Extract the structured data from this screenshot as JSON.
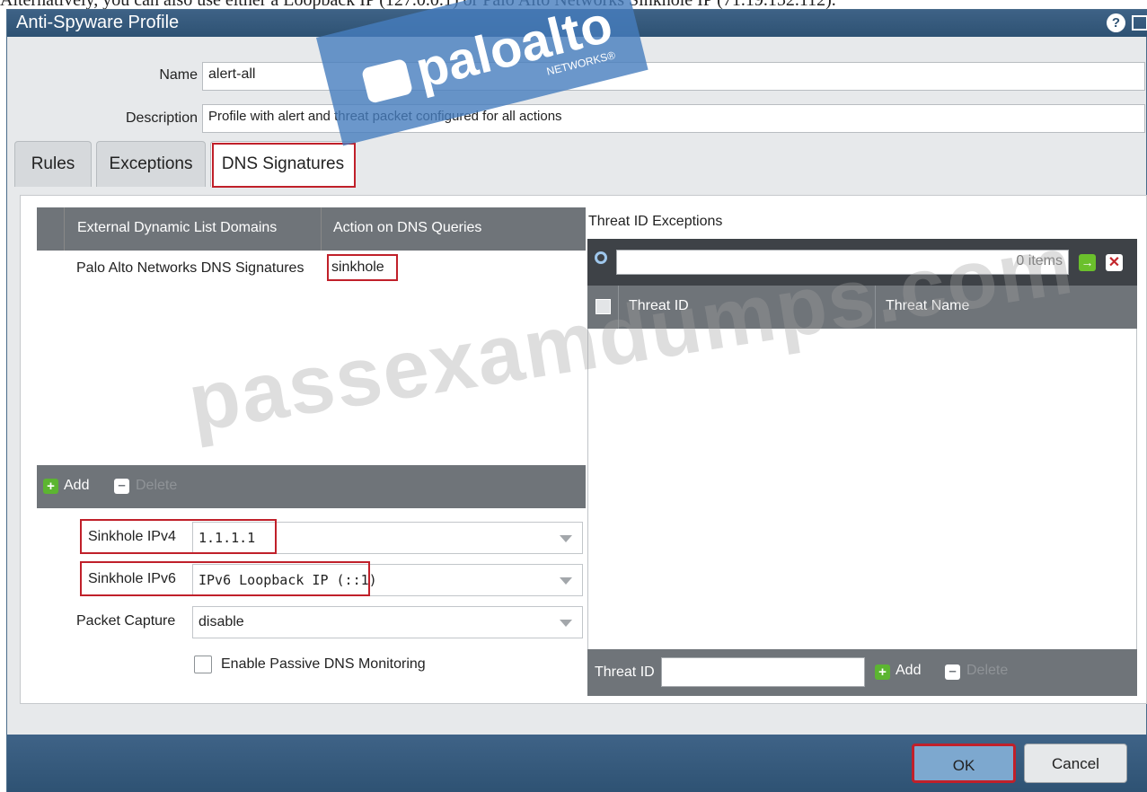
{
  "caption": "Alternatively, you can also use either a Loopback IP (127.0.0.1) or Palo Alto Networks Sinkhole IP (71.19.152.112).",
  "window": {
    "title": "Anti-Spyware Profile",
    "help_icon": "question-circle-icon",
    "maximize_icon": "maximize-icon"
  },
  "form": {
    "name_label": "Name",
    "name_value": "alert-all",
    "description_label": "Description",
    "description_value": "Profile with alert and threat packet configured for all actions"
  },
  "tabs": [
    {
      "label": "Rules"
    },
    {
      "label": "Exceptions"
    },
    {
      "label": "DNS Signatures",
      "active": true
    }
  ],
  "dns_table": {
    "headers": [
      "External Dynamic List Domains",
      "Action on DNS Queries"
    ],
    "rows": [
      {
        "domain": "Palo Alto Networks DNS Signatures",
        "action": "sinkhole"
      }
    ],
    "add_label": "Add",
    "delete_label": "Delete"
  },
  "sinkhole": {
    "ipv4_label": "Sinkhole IPv4",
    "ipv4_value": "1.1.1.1",
    "ipv6_label": "Sinkhole IPv6",
    "ipv6_value": "IPv6 Loopback IP (::1)",
    "packet_capture_label": "Packet Capture",
    "packet_capture_value": "disable",
    "passive_dns_label": "Enable Passive DNS Monitoring",
    "passive_dns_checked": false
  },
  "threat_exceptions": {
    "title": "Threat ID Exceptions",
    "items_count": "0 items",
    "headers": [
      "Threat ID",
      "Threat Name"
    ],
    "threat_id_label": "Threat ID",
    "add_label": "Add",
    "delete_label": "Delete"
  },
  "footer": {
    "ok_label": "OK",
    "cancel_label": "Cancel"
  },
  "watermarks": {
    "logo_text": "paloalto",
    "logo_subtext": "NETWORKS®",
    "site_text": "passexamdumps.com"
  }
}
